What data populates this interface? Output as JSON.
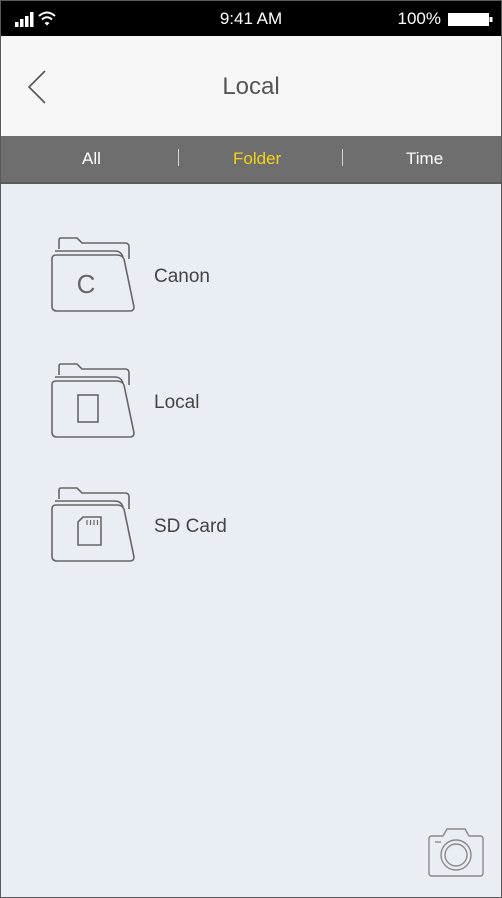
{
  "status_bar": {
    "time": "9:41 AM",
    "battery": "100%"
  },
  "nav": {
    "title": "Local"
  },
  "segments": {
    "all": "All",
    "folder": "Folder",
    "time": "Time",
    "active": "folder"
  },
  "folders": [
    {
      "label": "Canon",
      "icon": "canon-folder-icon"
    },
    {
      "label": "Local",
      "icon": "local-folder-icon"
    },
    {
      "label": "SD Card",
      "icon": "sd-card-folder-icon"
    }
  ],
  "colors": {
    "active_segment": "#f3d417",
    "segment_bar": "#6e6e6e",
    "background": "#e9edf4"
  }
}
